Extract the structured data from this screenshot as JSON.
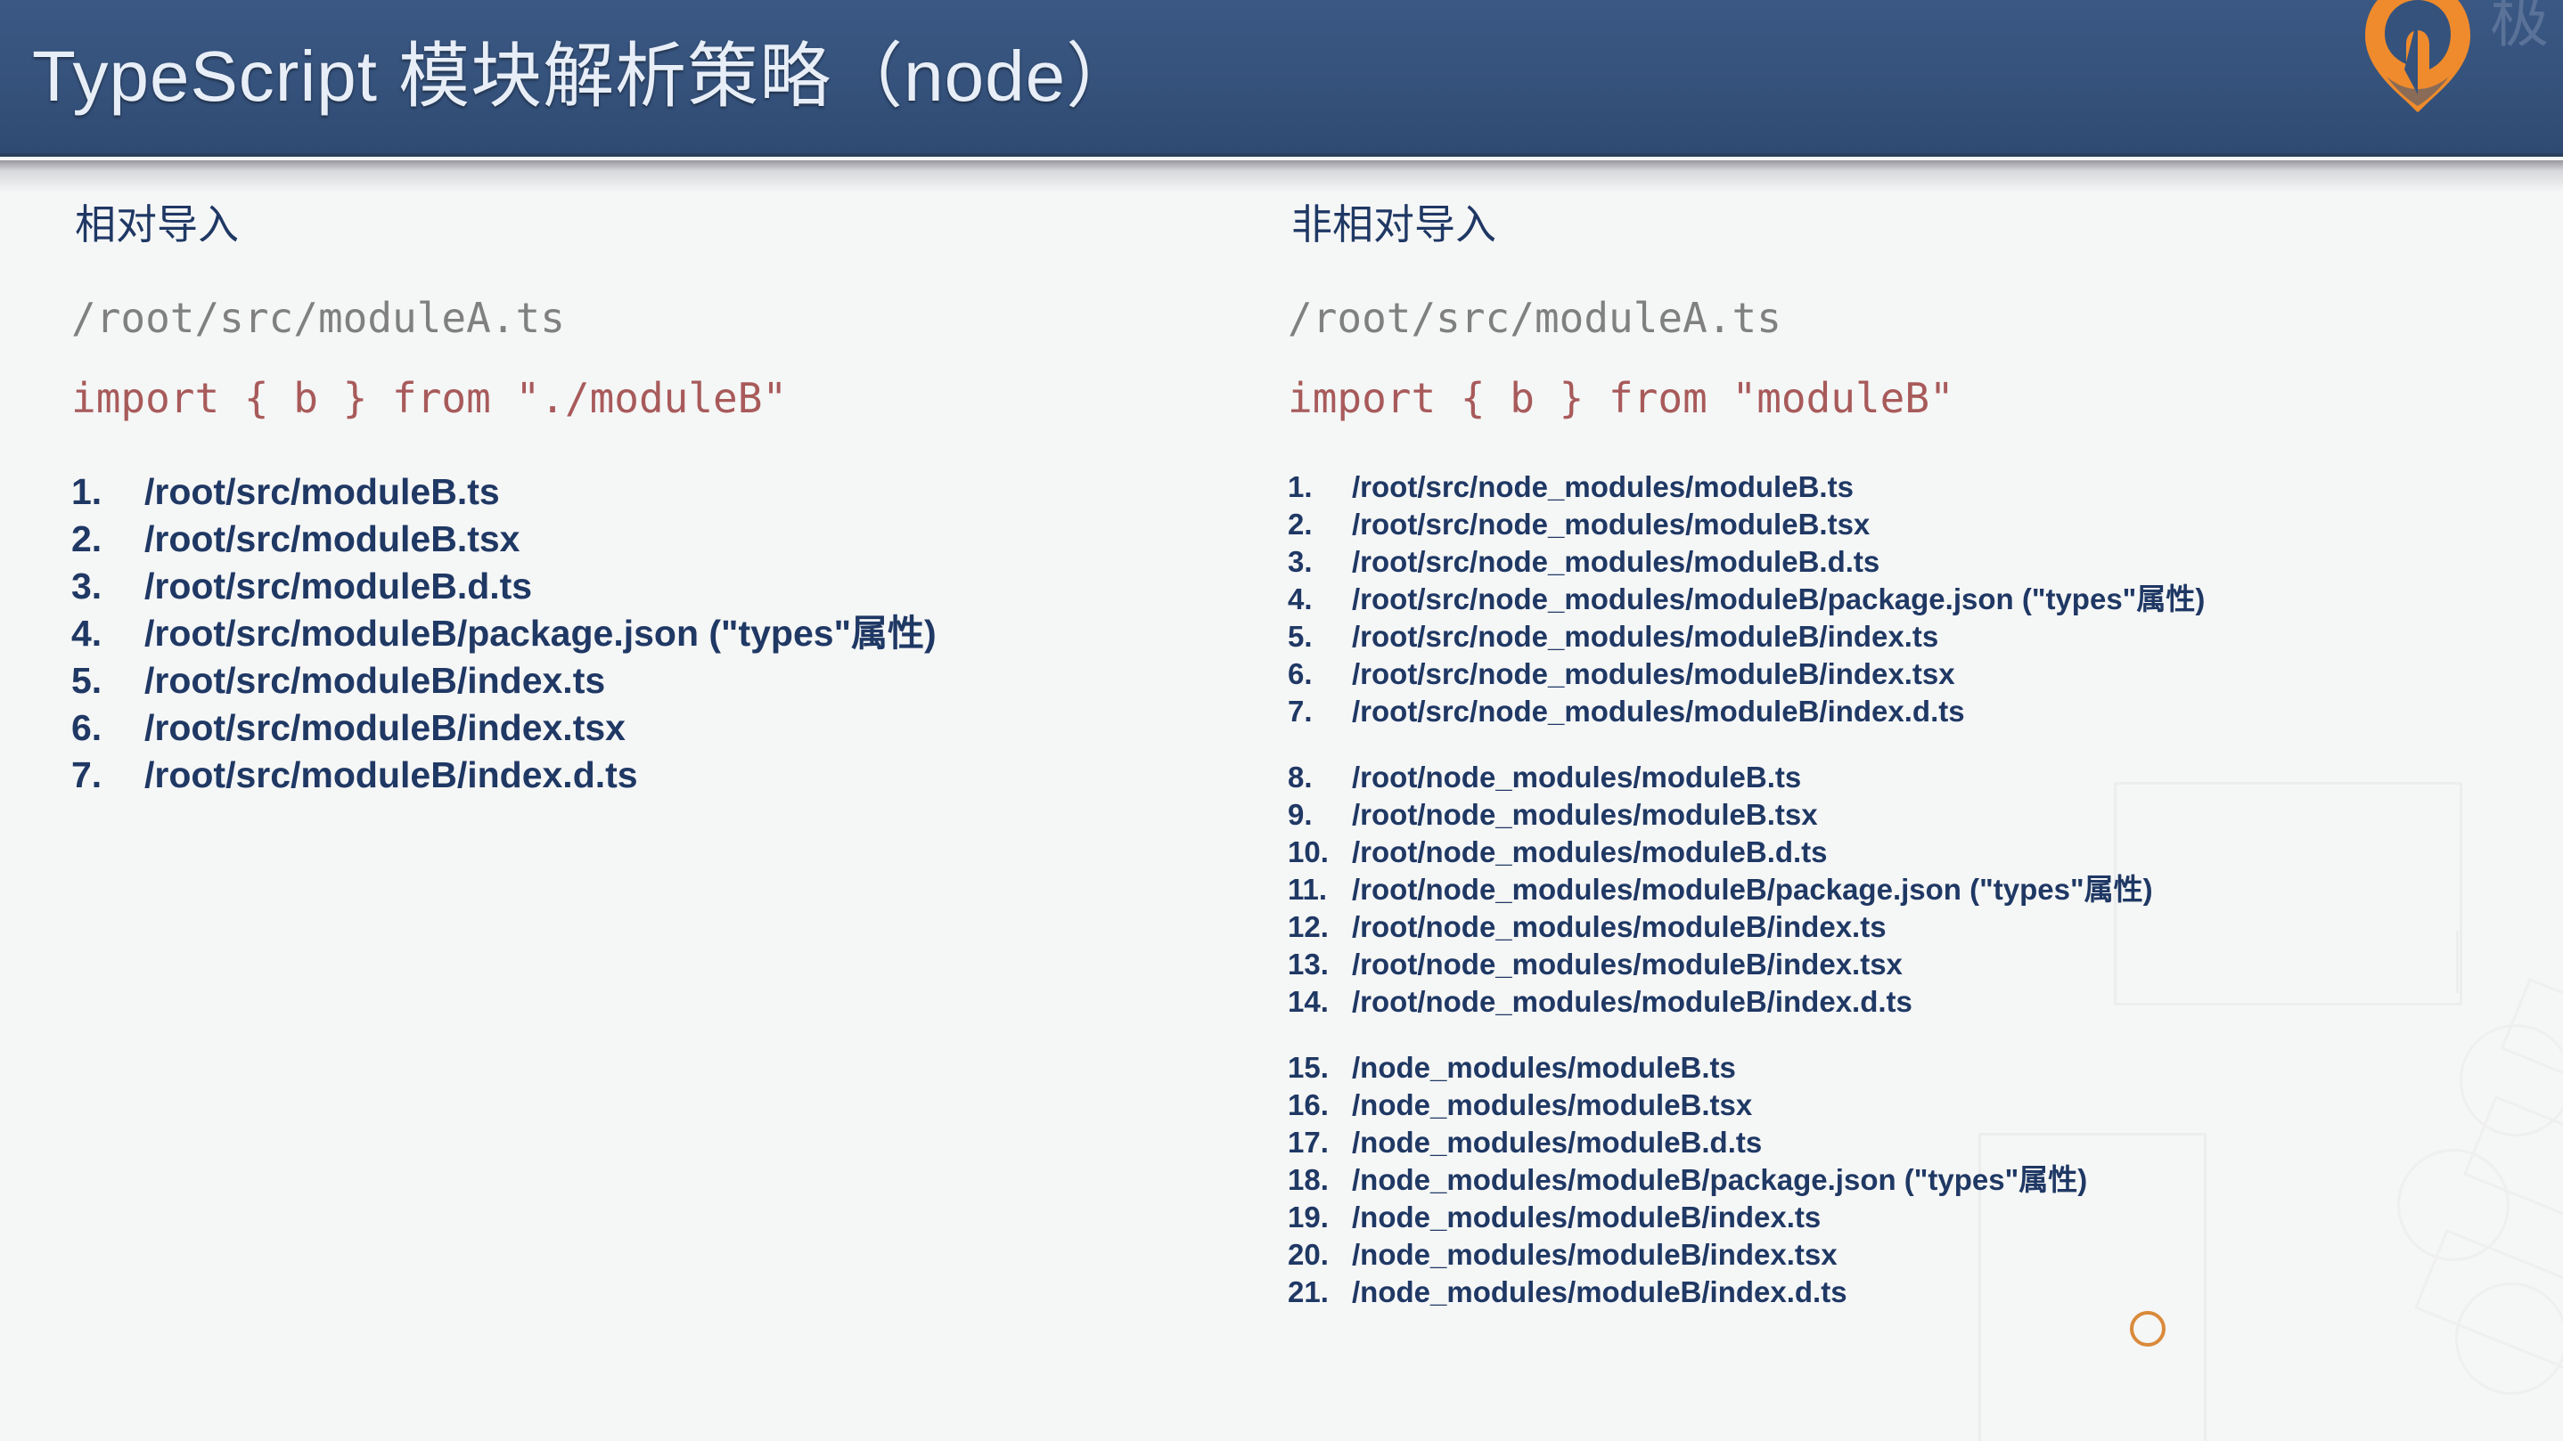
{
  "header": {
    "title": "TypeScript 模块解析策略（node）",
    "background_color": "#35527c",
    "title_color": "#e8eef7",
    "logo": {
      "mark_name": "geektime-logo-icon",
      "mark_color": "#ef8b2c",
      "text": "极"
    }
  },
  "theme": {
    "background_color": "#f5f6f6",
    "heading_color": "#1f3864",
    "path_color": "#808080",
    "code_color": "#a85a5a",
    "list_color": "#1f3864",
    "accent_color": "#d98a3a"
  },
  "left_column": {
    "heading": "相对导入",
    "file_path": "/root/src/moduleA.ts",
    "import_statement": "import { b } from \"./moduleB\"",
    "items": [
      {
        "num": "1.",
        "path": "/root/src/moduleB.ts"
      },
      {
        "num": "2.",
        "path": "/root/src/moduleB.tsx"
      },
      {
        "num": "3.",
        "path": "/root/src/moduleB.d.ts"
      },
      {
        "num": "4.",
        "path": "/root/src/moduleB/package.json (\"types\"属性)"
      },
      {
        "num": "5.",
        "path": "/root/src/moduleB/index.ts"
      },
      {
        "num": "6.",
        "path": "/root/src/moduleB/index.tsx"
      },
      {
        "num": "7.",
        "path": "/root/src/moduleB/index.d.ts"
      }
    ]
  },
  "right_column": {
    "heading": "非相对导入",
    "file_path": "/root/src/moduleA.ts",
    "import_statement": "import { b } from \"moduleB\"",
    "groups": [
      {
        "name": "src-node-modules",
        "items": [
          {
            "num": "1.",
            "path": "/root/src/node_modules/moduleB.ts"
          },
          {
            "num": "2.",
            "path": "/root/src/node_modules/moduleB.tsx"
          },
          {
            "num": "3.",
            "path": "/root/src/node_modules/moduleB.d.ts"
          },
          {
            "num": "4.",
            "path": "/root/src/node_modules/moduleB/package.json (\"types\"属性)"
          },
          {
            "num": "5.",
            "path": "/root/src/node_modules/moduleB/index.ts"
          },
          {
            "num": "6.",
            "path": "/root/src/node_modules/moduleB/index.tsx"
          },
          {
            "num": "7.",
            "path": "/root/src/node_modules/moduleB/index.d.ts"
          }
        ]
      },
      {
        "name": "root-node-modules",
        "items": [
          {
            "num": "8.",
            "path": "/root/node_modules/moduleB.ts"
          },
          {
            "num": "9.",
            "path": "/root/node_modules/moduleB.tsx"
          },
          {
            "num": "10.",
            "path": "/root/node_modules/moduleB.d.ts"
          },
          {
            "num": "11.",
            "path": "/root/node_modules/moduleB/package.json (\"types\"属性)"
          },
          {
            "num": "12.",
            "path": "/root/node_modules/moduleB/index.ts"
          },
          {
            "num": "13.",
            "path": "/root/node_modules/moduleB/index.tsx"
          },
          {
            "num": "14.",
            "path": "/root/node_modules/moduleB/index.d.ts"
          }
        ]
      },
      {
        "name": "global-node-modules",
        "items": [
          {
            "num": "15.",
            "path": "/node_modules/moduleB.ts"
          },
          {
            "num": "16.",
            "path": "/node_modules/moduleB.tsx"
          },
          {
            "num": "17.",
            "path": "/node_modules/moduleB.d.ts"
          },
          {
            "num": "18.",
            "path": "/node_modules/moduleB/package.json (\"types\"属性)"
          },
          {
            "num": "19.",
            "path": "/node_modules/moduleB/index.ts"
          },
          {
            "num": "20.",
            "path": "/node_modules/moduleB/index.tsx"
          },
          {
            "num": "21.",
            "path": "/node_modules/moduleB/index.d.ts"
          }
        ]
      }
    ]
  }
}
